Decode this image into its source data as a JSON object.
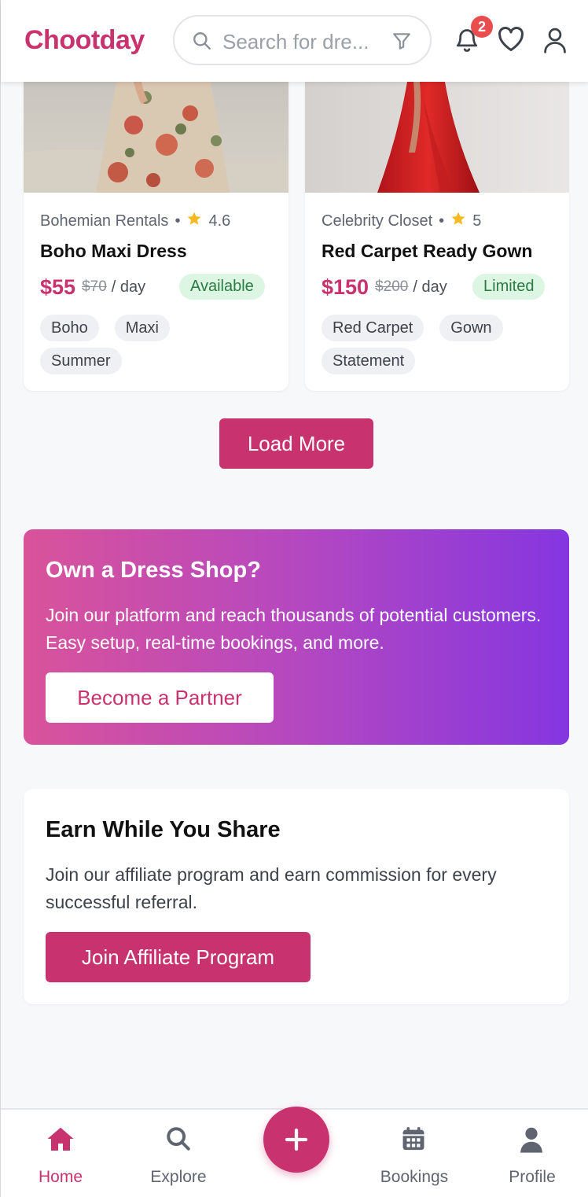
{
  "header": {
    "brand": "Chootday",
    "search_placeholder": "Search for dre...",
    "notification_count": "2"
  },
  "products": [
    {
      "shop": "Bohemian Rentals",
      "rating": "4.6",
      "name": "Boho Maxi Dress",
      "price": "$55",
      "old_price": "$70",
      "per": "/ day",
      "status": "Available",
      "tags": [
        "Boho",
        "Maxi",
        "Summer"
      ]
    },
    {
      "shop": "Celebrity Closet",
      "rating": "5",
      "name": "Red Carpet Ready Gown",
      "price": "$150",
      "old_price": "$200",
      "per": "/ day",
      "status": "Limited",
      "tags": [
        "Red Carpet",
        "Gown",
        "Statement"
      ]
    }
  ],
  "load_more": "Load More",
  "partner": {
    "title": "Own a Dress Shop?",
    "text": "Join our platform and reach thousands of potential customers. Easy setup, real-time bookings, and more.",
    "button": "Become a Partner"
  },
  "affiliate": {
    "title": "Earn While You Share",
    "text": "Join our affiliate program and earn commission for every successful referral.",
    "button": "Join Affiliate Program"
  },
  "nav": {
    "home": "Home",
    "explore": "Explore",
    "bookings": "Bookings",
    "profile": "Profile"
  },
  "colors": {
    "brand": "#c8336f",
    "available_bg": "#dcf6e3",
    "gradient_start": "#d9539a",
    "gradient_end": "#8536e0"
  }
}
